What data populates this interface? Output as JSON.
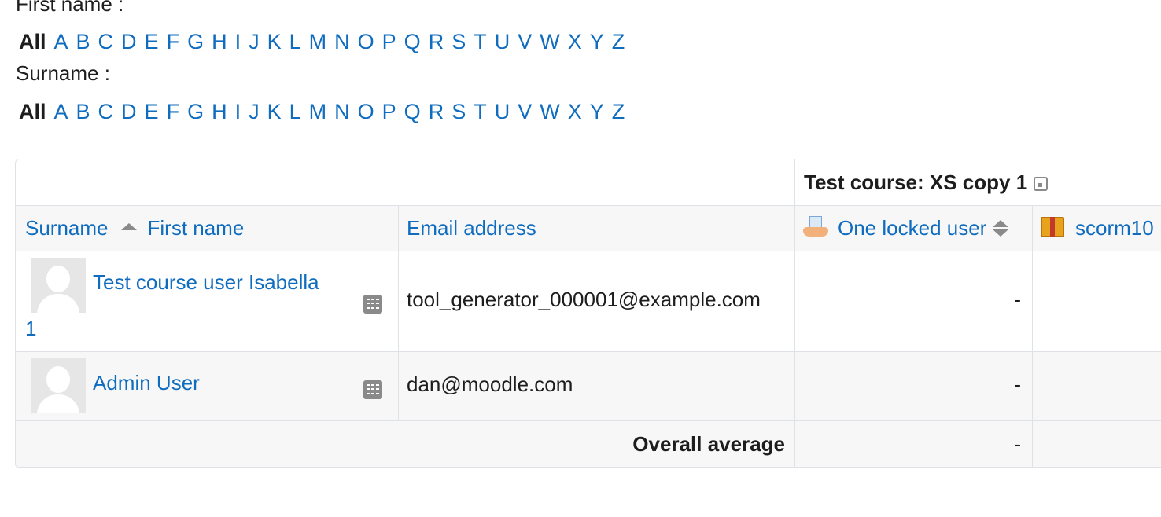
{
  "initials": {
    "firstname_label": "First name :",
    "surname_label": "Surname :",
    "all_label": "All",
    "letters": [
      "A",
      "B",
      "C",
      "D",
      "E",
      "F",
      "G",
      "H",
      "I",
      "J",
      "K",
      "L",
      "M",
      "N",
      "O",
      "P",
      "Q",
      "R",
      "S",
      "T",
      "U",
      "V",
      "W",
      "X",
      "Y",
      "Z"
    ]
  },
  "table": {
    "course_header": "Test course: XS copy 1",
    "columns": {
      "surname": "Surname",
      "firstname": "First name",
      "email": "Email address",
      "item1": "One locked user",
      "item2": "scorm10"
    },
    "rows": [
      {
        "name_line1": "Test course user Isabella",
        "name_line2": "1",
        "email": "tool_generator_000001@example.com",
        "grade1": "-"
      },
      {
        "name_line1": "Admin User",
        "email": "dan@moodle.com",
        "grade1": "-"
      }
    ],
    "average": {
      "label": "Overall average",
      "grade1": "-"
    }
  }
}
